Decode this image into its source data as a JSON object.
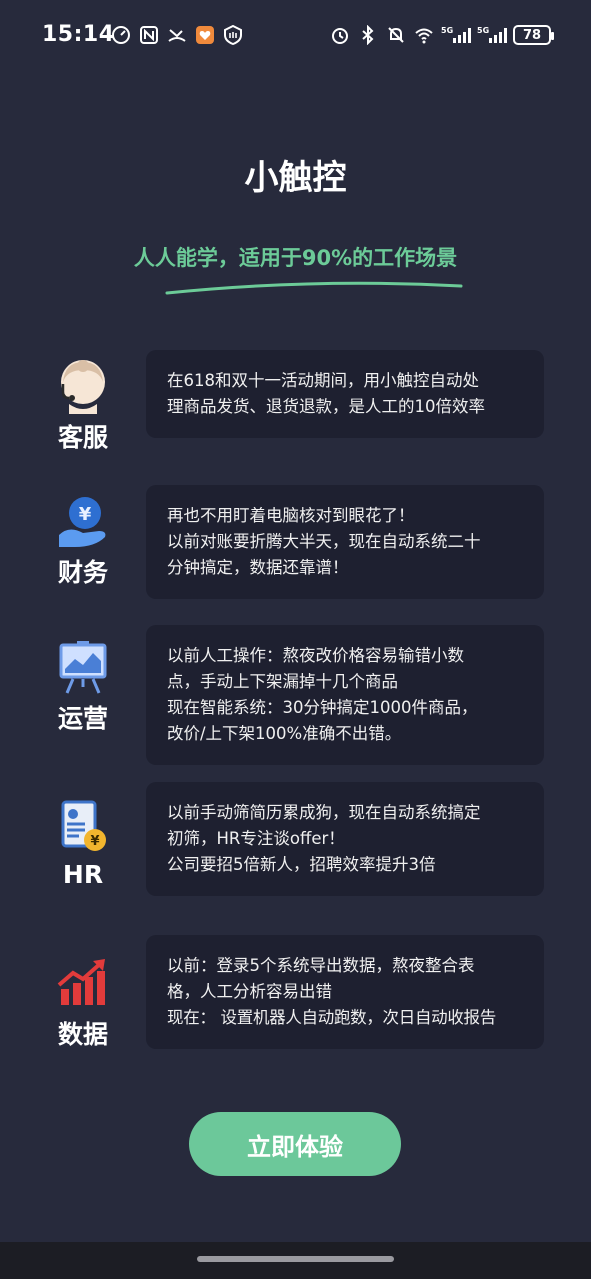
{
  "status_bar": {
    "time": "15:14",
    "battery": "78",
    "left_icons": [
      "speed-icon",
      "nfc-icon",
      "missed-call-icon",
      "app-notification-icon",
      "shield-hand-icon"
    ],
    "right_icons": [
      "alarm-icon",
      "bluetooth-icon",
      "mute-icon",
      "wifi-icon",
      "signal-5g-1-icon",
      "signal-5g-2-icon"
    ],
    "signal_label": "5G"
  },
  "header": {
    "title": "小触控",
    "subtitle": "人人能学，适用于90%的工作场景"
  },
  "features": [
    {
      "label": "客服",
      "icon": "customer-service-icon",
      "lines": [
        "在618和双十一活动期间，用小触控自动处",
        "理商品发货、退货退款，是人工的10倍效率"
      ]
    },
    {
      "label": "财务",
      "icon": "finance-icon",
      "lines": [
        "再也不用盯着电脑核对到眼花了！",
        "以前对账要折腾大半天，现在自动系统二十",
        "分钟搞定，数据还靠谱！"
      ]
    },
    {
      "label": "运营",
      "icon": "operations-icon",
      "lines": [
        "以前人工操作：熬夜改价格容易输错小数",
        "点，手动上下架漏掉十几个商品",
        "现在智能系统：30分钟搞定1000件商品，",
        "改价/上下架100%准确不出错。"
      ]
    },
    {
      "label": "HR",
      "icon": "hr-resume-icon",
      "lines": [
        "以前手动筛简历累成狗，现在自动系统搞定",
        "初筛，HR专注谈offer！",
        "公司要招5倍新人，招聘效率提升3倍"
      ]
    },
    {
      "label": "数据",
      "icon": "data-chart-icon",
      "lines": [
        "以前：登录5个系统导出数据，熬夜整合表",
        "格，人工分析容易出错",
        "现在： 设置机器人自动跑数，次日自动收报告"
      ]
    }
  ],
  "cta": {
    "label": "立即体验"
  },
  "colors": {
    "background": "#272A3C",
    "card": "#1E2030",
    "accent": "#6CC89A"
  }
}
